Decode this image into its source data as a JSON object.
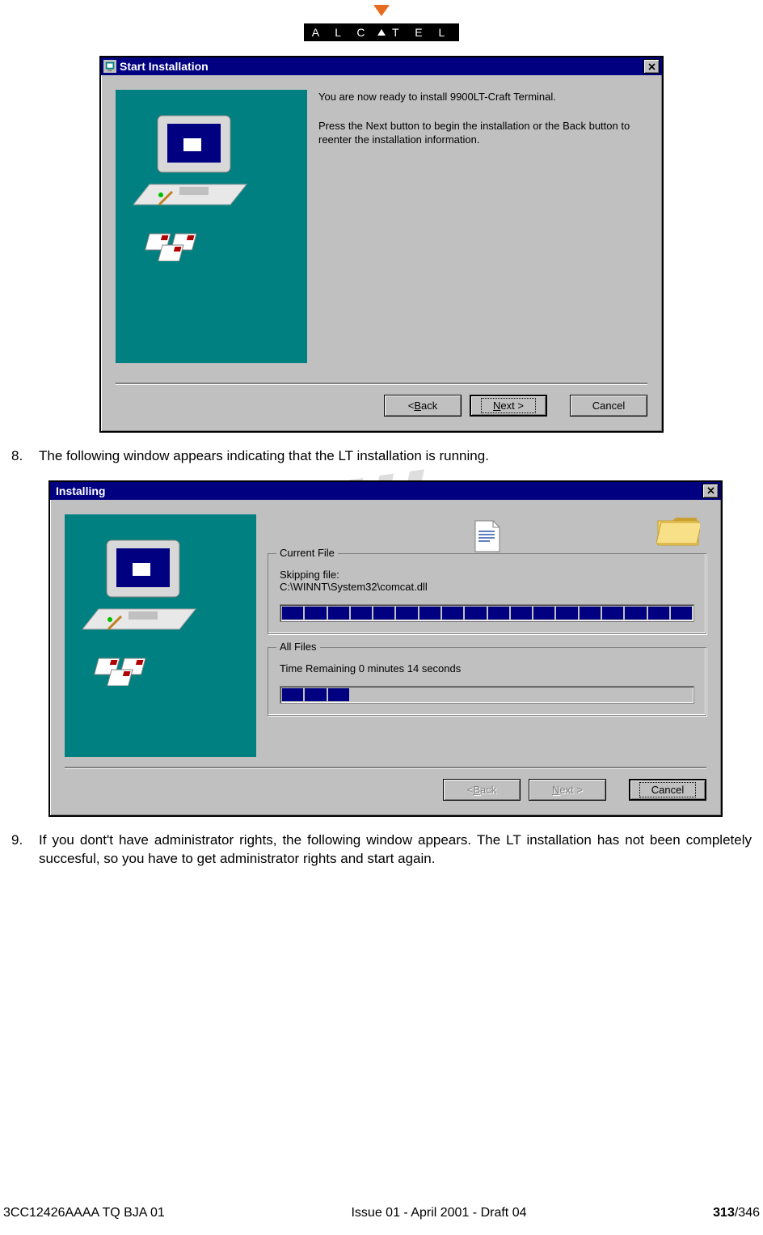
{
  "logo": {
    "brand": "A L C A T E L"
  },
  "dialog1": {
    "title": "Start Installation",
    "para1": "You are now ready to install 9900LT-Craft Terminal.",
    "para2": "Press the Next button to begin the installation or the Back button to reenter the installation information.",
    "back": "< Back",
    "back_u": "B",
    "next": "Next >",
    "next_u": "N",
    "cancel": "Cancel",
    "side_w": 237,
    "side_h": 338
  },
  "step8": {
    "num": "8.",
    "text": "The following window appears indicating that the LT installation is running."
  },
  "dialog2": {
    "title": "Installing",
    "group1": {
      "legend": "Current File",
      "line1": "Skipping file:",
      "line2": "C:\\WINNT\\System32\\comcat.dll",
      "progress_segments": 18,
      "progress_filled": 18
    },
    "group2": {
      "legend": "All Files",
      "line1": "Time Remaining 0 minutes 14 seconds",
      "progress_segments": 18,
      "progress_filled": 3
    },
    "back": "< Back",
    "back_u": "B",
    "next": "Next >",
    "next_u": "N",
    "cancel": "Cancel",
    "side_w": 237,
    "side_h": 300
  },
  "step9": {
    "num": "9.",
    "text": "If you dont't have administrator rights, the following window appears. The LT installation has not been completely succesful, so you have to get administrator rights and start again."
  },
  "footer": {
    "left": "3CC12426AAAA TQ BJA 01",
    "center": "Issue 01 - April 2001 - Draft 04",
    "page_cur": "313",
    "page_tot": "/346"
  }
}
